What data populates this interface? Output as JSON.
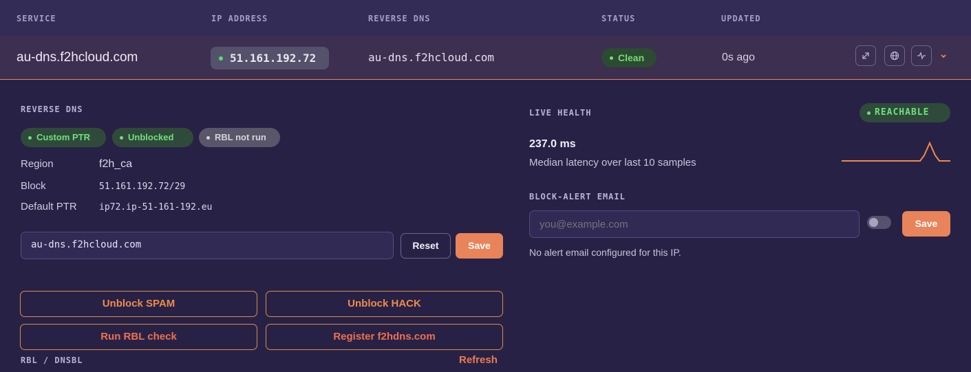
{
  "table": {
    "headers": {
      "service": "SERVICE",
      "ip": "IP ADDRESS",
      "rdns": "REVERSE DNS",
      "status": "STATUS",
      "updated": "UPDATED"
    },
    "row": {
      "service": "au-dns.f2hcloud.com",
      "ip": "51.161.192.72",
      "rdns": "au-dns.f2hcloud.com",
      "status": "Clean",
      "updated": "0s ago",
      "actions": [
        "external-link-icon",
        "globe-icon",
        "pulse-icon",
        "chevron-down-icon"
      ]
    }
  },
  "reverse_dns": {
    "title": "REVERSE DNS",
    "badges": [
      "Custom PTR",
      "Unblocked",
      "RBL not run"
    ],
    "region_label": "Region",
    "region_value": "f2h_ca",
    "block_label": "Block",
    "block_value": "51.161.192.72/29",
    "ptr_label": "Default PTR",
    "ptr_value": "ip72.ip-51-161-192.eu",
    "input_value": "au-dns.f2hcloud.com",
    "reset_label": "Reset",
    "save_label": "Save",
    "actions": {
      "unblock_spam": "Unblock SPAM",
      "unblock_hack": "Unblock HACK",
      "run_rbl": "Run RBL check",
      "register": "Register f2hdns.com"
    },
    "rbl_title": "RBL / DNSBL",
    "refresh_label": "Refresh"
  },
  "live_health": {
    "title": "LIVE HEALTH",
    "status": "REACHABLE",
    "latency": "237.0 ms",
    "latency_sub": "Median latency over last 10 samples"
  },
  "alert": {
    "title": "BLOCK-ALERT EMAIL",
    "placeholder": "you@example.com",
    "toggle_on": false,
    "save_label": "Save",
    "note": "No alert email configured for this IP."
  },
  "colors": {
    "accent": "#e8835a",
    "green": "#6fe07a",
    "background": "#272245"
  }
}
